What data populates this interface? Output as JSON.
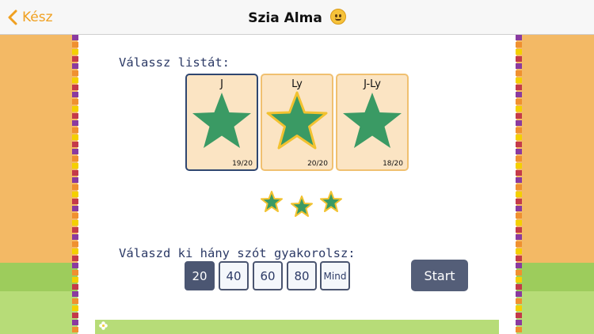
{
  "nav": {
    "back_label": "Kész",
    "title": "Szia Alma"
  },
  "main": {
    "list_heading": "Válassz listát:",
    "lists": [
      {
        "label": "J",
        "score": "19/20",
        "selected": true
      },
      {
        "label": "Ly",
        "score": "20/20",
        "selected": false
      },
      {
        "label": "J-Ly",
        "score": "18/20",
        "selected": false
      }
    ],
    "earned_stars": 3,
    "count_heading": "Válaszd ki hány szót gyakorolsz:",
    "count_options": [
      "20",
      "40",
      "60",
      "80",
      "Mind"
    ],
    "selected_count": "20",
    "start_label": "Start"
  },
  "colors": {
    "accent": "#f0a020",
    "star_green": "#3a9a64",
    "star_outline_gold": "#f2c230",
    "button_dark": "#4b5672",
    "background_orange": "#f3b965",
    "grass": "#9dcc5c"
  }
}
